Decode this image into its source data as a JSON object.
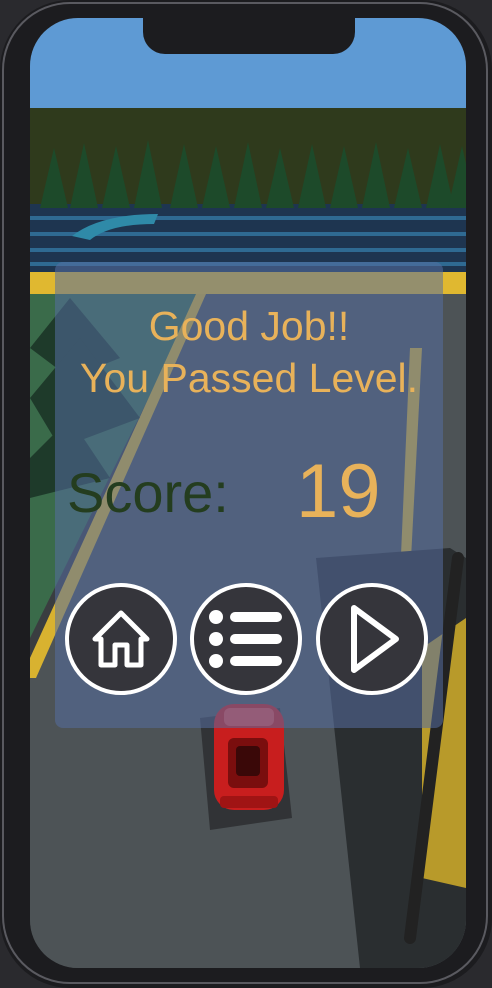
{
  "result": {
    "line1": "Good Job!!",
    "line2": "You Passed Level.",
    "score_label": "Score:",
    "score_value": "19"
  },
  "buttons": {
    "home": "home-icon",
    "menu": "list-icon",
    "next": "play-icon"
  },
  "colors": {
    "accent_text": "#e8b25a",
    "score_label": "#243d1f",
    "button_fill": "#35353b",
    "button_border": "#ffffff",
    "car": "#c81e1e"
  }
}
